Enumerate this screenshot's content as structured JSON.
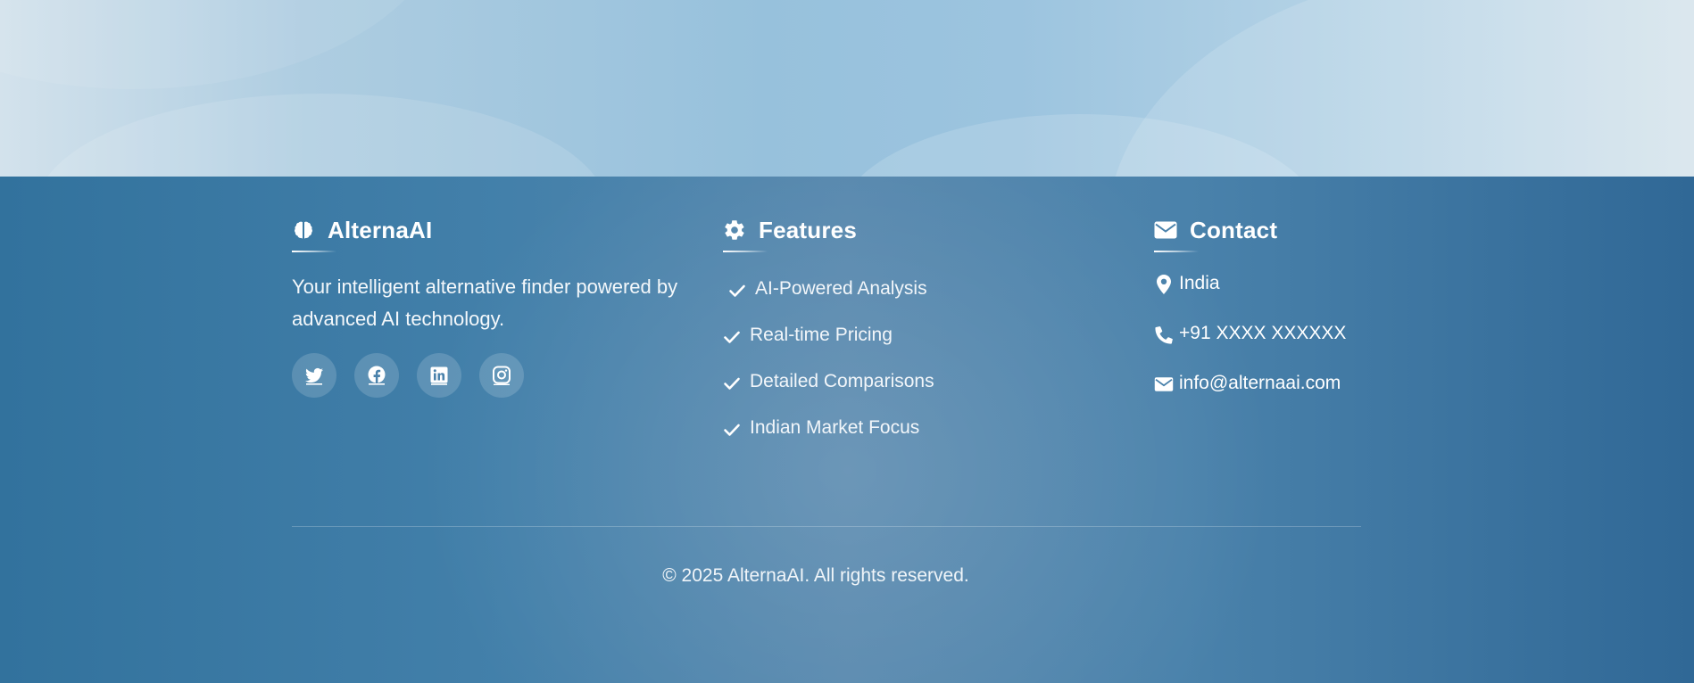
{
  "colors": {
    "footer_bg_left": "#32729d",
    "footer_bg_center": "#5687ad",
    "footer_bg_right": "#306896",
    "hero_bg": "#9cc4df",
    "text": "#ffffff"
  },
  "brand": {
    "icon": "brain-icon",
    "title": "AlternaAI",
    "description": "Your intelligent alternative finder powered by advanced AI technology.",
    "socials": [
      {
        "icon": "twitter-icon"
      },
      {
        "icon": "facebook-icon"
      },
      {
        "icon": "linkedin-icon"
      },
      {
        "icon": "instagram-icon"
      }
    ]
  },
  "features": {
    "icon": "gear-icon",
    "title": "Features",
    "items": [
      {
        "label": "AI-Powered Analysis",
        "icon": "check-icon"
      },
      {
        "label": "Real-time Pricing",
        "icon": "check-icon"
      },
      {
        "label": "Detailed Comparisons",
        "icon": "check-icon"
      },
      {
        "label": "Indian Market Focus",
        "icon": "check-icon"
      }
    ]
  },
  "contact": {
    "icon": "envelope-icon",
    "title": "Contact",
    "items": [
      {
        "label": "India",
        "icon": "map-pin-icon"
      },
      {
        "label": "+91 XXXX XXXXXX",
        "icon": "phone-icon"
      },
      {
        "label": "info@alternaai.com",
        "icon": "envelope-icon"
      }
    ]
  },
  "footer": {
    "copyright": "© 2025 AlternaAI. All rights reserved."
  }
}
